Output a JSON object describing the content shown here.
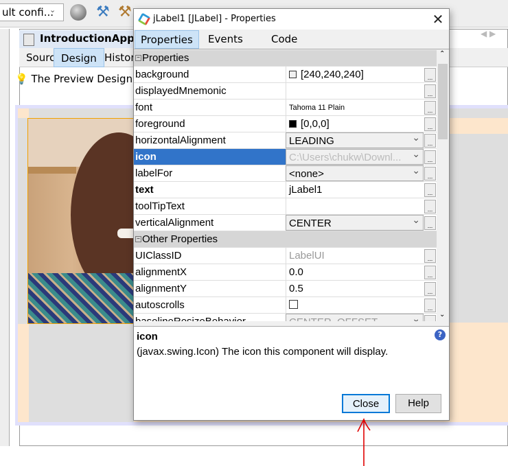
{
  "toolbar": {
    "config_combo": "ult confi...",
    "icons": [
      "globe-icon",
      "hammer-icon",
      "clean-build-icon"
    ]
  },
  "editor": {
    "file_tab": "IntroductionApp.java",
    "view_tabs": [
      "Source",
      "Design",
      "History"
    ],
    "active_view": "Design",
    "hint": "The Preview Design b"
  },
  "dialog": {
    "title": "jLabel1 [JLabel] - Properties",
    "tabs": [
      "Properties",
      "Events",
      "Code"
    ],
    "active_tab": "Properties",
    "rows": [
      {
        "type": "header",
        "name": "Properties"
      },
      {
        "name": "background",
        "value": "[240,240,240]",
        "swatch": "#f0f0f0"
      },
      {
        "name": "displayedMnemonic",
        "value": ""
      },
      {
        "name": "font",
        "value": "Tahoma 11 Plain",
        "small": true
      },
      {
        "name": "foreground",
        "value": "[0,0,0]",
        "swatch": "#000000"
      },
      {
        "name": "horizontalAlignment",
        "value": "LEADING",
        "combo": true
      },
      {
        "name": "icon",
        "value": "C:\\Users\\chukw\\Downl...",
        "combo": true,
        "selected": true,
        "bold": true
      },
      {
        "name": "labelFor",
        "value": "<none>",
        "combo": true
      },
      {
        "name": "text",
        "value": "jLabel1",
        "bold": true
      },
      {
        "name": "toolTipText",
        "value": ""
      },
      {
        "name": "verticalAlignment",
        "value": "CENTER",
        "combo": true
      },
      {
        "type": "header",
        "name": "Other Properties"
      },
      {
        "name": "UIClassID",
        "value": "LabelUI",
        "readonly": true
      },
      {
        "name": "alignmentX",
        "value": "0.0"
      },
      {
        "name": "alignmentY",
        "value": "0.5"
      },
      {
        "name": "autoscrolls",
        "value": "",
        "checkbox": true
      },
      {
        "name": "baselineResizeBehavior",
        "value": "CENTER_OFFSET",
        "combo": true,
        "readonly": true
      }
    ],
    "description": {
      "title": "icon",
      "text": "(javax.swing.Icon) The icon this component will display."
    },
    "close_label": "Close",
    "help_label": "Help"
  },
  "colors": {
    "selection": "#3174c9",
    "accent_button": "#0078d7",
    "annotation_arrow": "#e00000"
  }
}
